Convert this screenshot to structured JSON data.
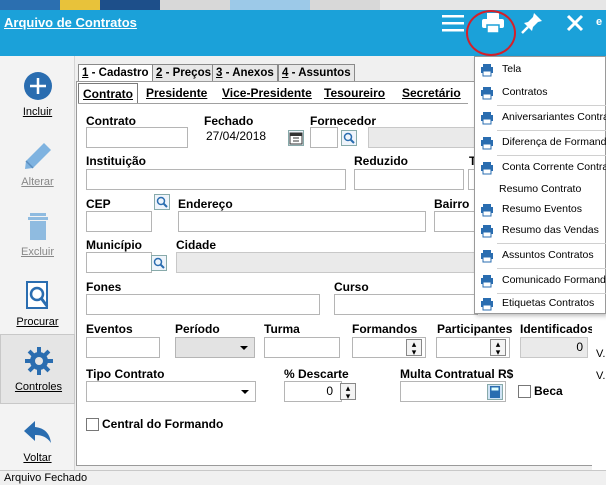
{
  "window": {
    "title": "Arquivo de Contratos",
    "status": "Arquivo Fechado",
    "edge_text": "e",
    "accent": "#1ba1d9",
    "highlight_ring": "#d4202a"
  },
  "sidebar": {
    "items": [
      {
        "label": "Incluir",
        "icon": "plus-circle-icon"
      },
      {
        "label": "Alterar",
        "icon": "pencil-icon"
      },
      {
        "label": "Excluir",
        "icon": "trash-icon"
      },
      {
        "label": "Procurar",
        "icon": "magnifier-document-icon"
      },
      {
        "label": "Controles",
        "icon": "gear-icon"
      },
      {
        "label": "Voltar",
        "icon": "back-arrow-icon"
      }
    ]
  },
  "page_tabs": [
    {
      "num": "1",
      "label": "Cadastro"
    },
    {
      "num": "2",
      "label": "Preços"
    },
    {
      "num": "3",
      "label": "Anexos"
    },
    {
      "num": "4",
      "label": "Assuntos"
    }
  ],
  "sub_tabs": [
    "Contrato",
    "Presidente",
    "Vice-Presidente",
    "Tesoureiro",
    "Secretário"
  ],
  "form": {
    "contrato_label": "Contrato",
    "contrato_value": "",
    "fechado_label": "Fechado",
    "fechado_value": "27/04/2018",
    "fornecedor_label": "Fornecedor",
    "instituicao_label": "Instituição",
    "reduzido_label": "Reduzido",
    "t_label": "T",
    "cep_label": "CEP",
    "endereco_label": "Endereço",
    "bairro_label": "Bairro",
    "municipio_label": "Município",
    "cidade_label": "Cidade",
    "fones_label": "Fones",
    "curso_label": "Curso",
    "eventos_label": "Eventos",
    "periodo_label": "Período",
    "turma_label": "Turma",
    "formandos_label": "Formandos",
    "participantes_label": "Participantes",
    "identificados_label": "Identificados",
    "identificados_value": "0",
    "tipo_contrato_label": "Tipo Contrato",
    "descarte_label": "% Descarte",
    "descarte_value": "0",
    "multa_label": "Multa Contratual R$",
    "beca_label": "Beca",
    "central_label": "Central do Formando"
  },
  "print_menu": {
    "items": [
      "Tela",
      "Contratos",
      "Aniversariantes Contrato",
      "Diferença de Formandos",
      "Conta Corrente Contrato",
      "Resumo Contrato",
      "Resumo Eventos",
      "Resumo das Vendas",
      "Assuntos Contratos",
      "Comunicado Formandos",
      "Etiquetas Contratos"
    ]
  },
  "edge_fragments": [
    "V.",
    "V."
  ]
}
